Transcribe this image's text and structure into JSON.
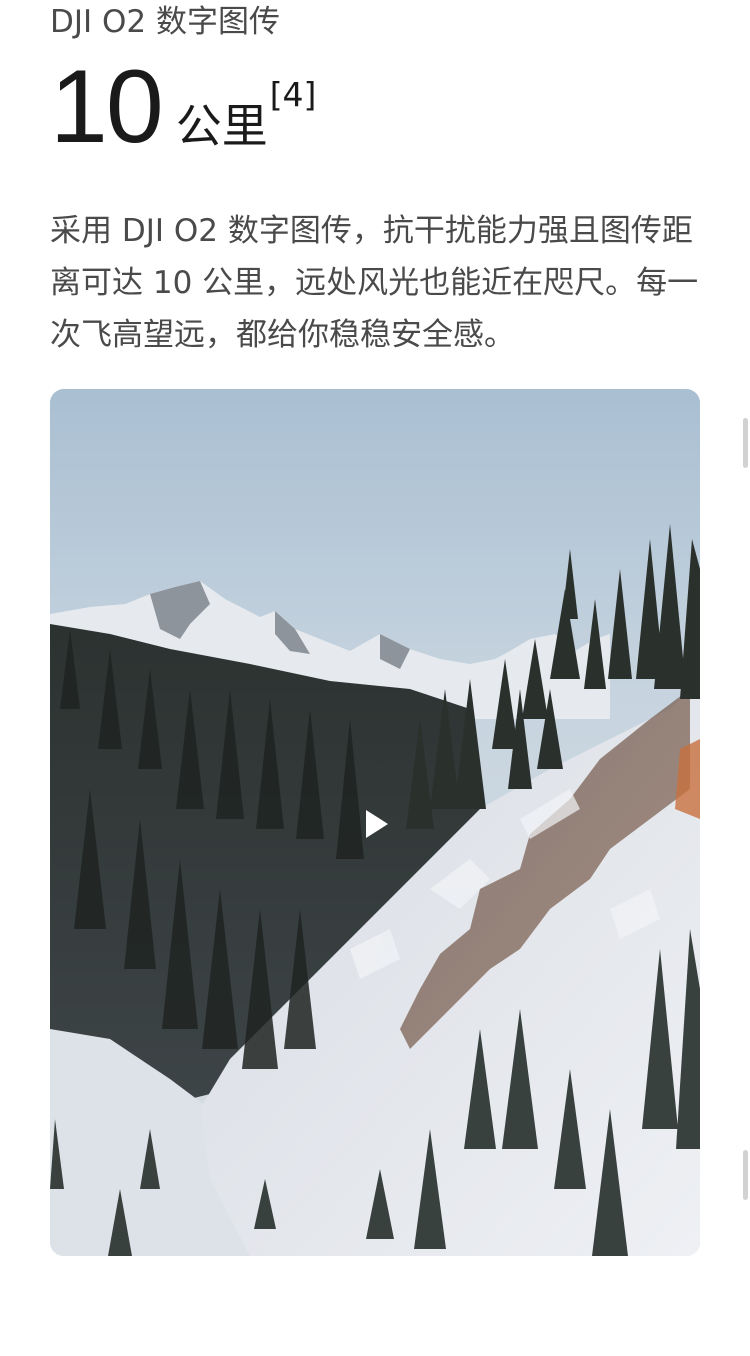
{
  "section": {
    "kicker": "DJI O2 数字图传",
    "headline_number": "10",
    "headline_unit": "公里",
    "headline_footnote": "[4]",
    "description": "采用 DJI O2 数字图传，抗干扰能力强且图传距离可达 10 公里，远处风光也能近在咫尺。每一次飞高望远，都给你稳稳安全感。"
  },
  "video": {
    "play_icon": "play-icon",
    "accent_color": "#ffffff"
  }
}
